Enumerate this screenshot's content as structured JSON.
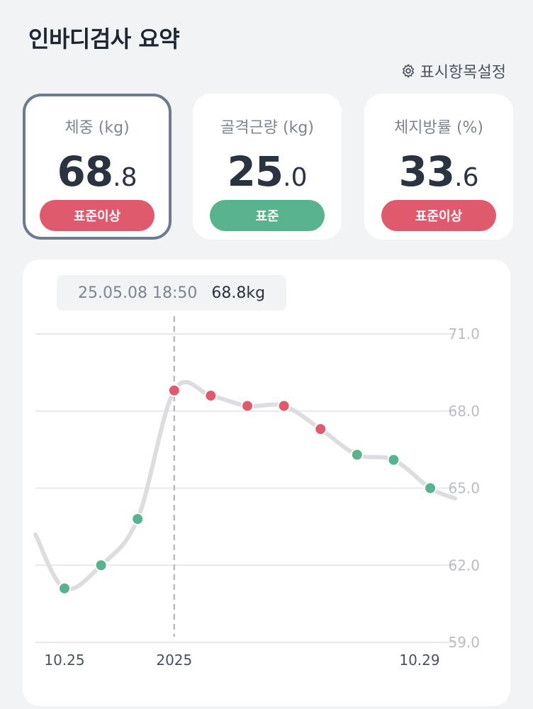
{
  "header": {
    "title": "인바디검사 요약"
  },
  "settings": {
    "label": "표시항목설정",
    "icon": "gear-icon"
  },
  "metrics": [
    {
      "label": "체중 (kg)",
      "int": "68",
      "dec": ".8",
      "status": "표준이상",
      "status_color": "#e05a6d",
      "selected": true
    },
    {
      "label": "골격근량 (kg)",
      "int": "25",
      "dec": ".0",
      "status": "표준",
      "status_color": "#5ab38f",
      "selected": false
    },
    {
      "label": "체지방률 (%)",
      "int": "33",
      "dec": ".6",
      "status": "표준이상",
      "status_color": "#e05a6d",
      "selected": false
    }
  ],
  "tooltip": {
    "date": "25.05.08 18:50",
    "value": "68.8kg"
  },
  "chart_data": {
    "type": "line",
    "y_ticks": [
      "71.0",
      "68.0",
      "65.0",
      "62.0",
      "59.0"
    ],
    "ylim": [
      59.0,
      71.0
    ],
    "x_labels": [
      "10.25",
      "2025",
      "10.29"
    ],
    "series": [
      {
        "values": [
          61.1,
          62.0,
          63.8,
          68.8,
          68.6,
          68.2,
          68.2,
          67.3,
          66.3,
          66.1,
          65.0
        ],
        "status": [
          "normal",
          "normal",
          "normal",
          "above",
          "above",
          "above",
          "above",
          "above",
          "normal",
          "normal",
          "normal"
        ]
      }
    ],
    "selected_index": 3,
    "colors": {
      "above": "#e05a6d",
      "normal": "#5ab38f",
      "line": "#dcdde1",
      "grid": "#e8e9ec",
      "tick": "#b9bdc4"
    },
    "grid": true
  }
}
